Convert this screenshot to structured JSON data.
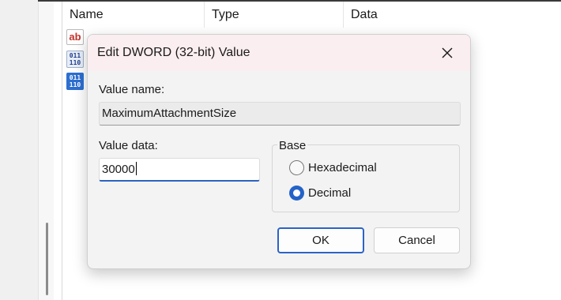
{
  "background": {
    "columns": [
      "Name",
      "Type",
      "Data"
    ],
    "rows": [
      {
        "icon": "string-value-icon",
        "glyph": "ab"
      },
      {
        "icon": "binary-value-icon",
        "glyph": "011\n110"
      },
      {
        "icon": "binary-value-icon",
        "glyph": "011\n110"
      }
    ]
  },
  "dialog": {
    "title": "Edit DWORD (32-bit) Value",
    "value_name_label": "Value name:",
    "value_name": "MaximumAttachmentSize",
    "value_data_label": "Value data:",
    "value_data": "30000",
    "base_label": "Base",
    "base_options": [
      {
        "label": "Hexadecimal",
        "selected": false
      },
      {
        "label": "Decimal",
        "selected": true
      }
    ],
    "ok_label": "OK",
    "cancel_label": "Cancel"
  },
  "colors": {
    "accent": "#2463c7",
    "titlebar": "#fbeef0",
    "dialog_bg": "#f3f3f3"
  }
}
